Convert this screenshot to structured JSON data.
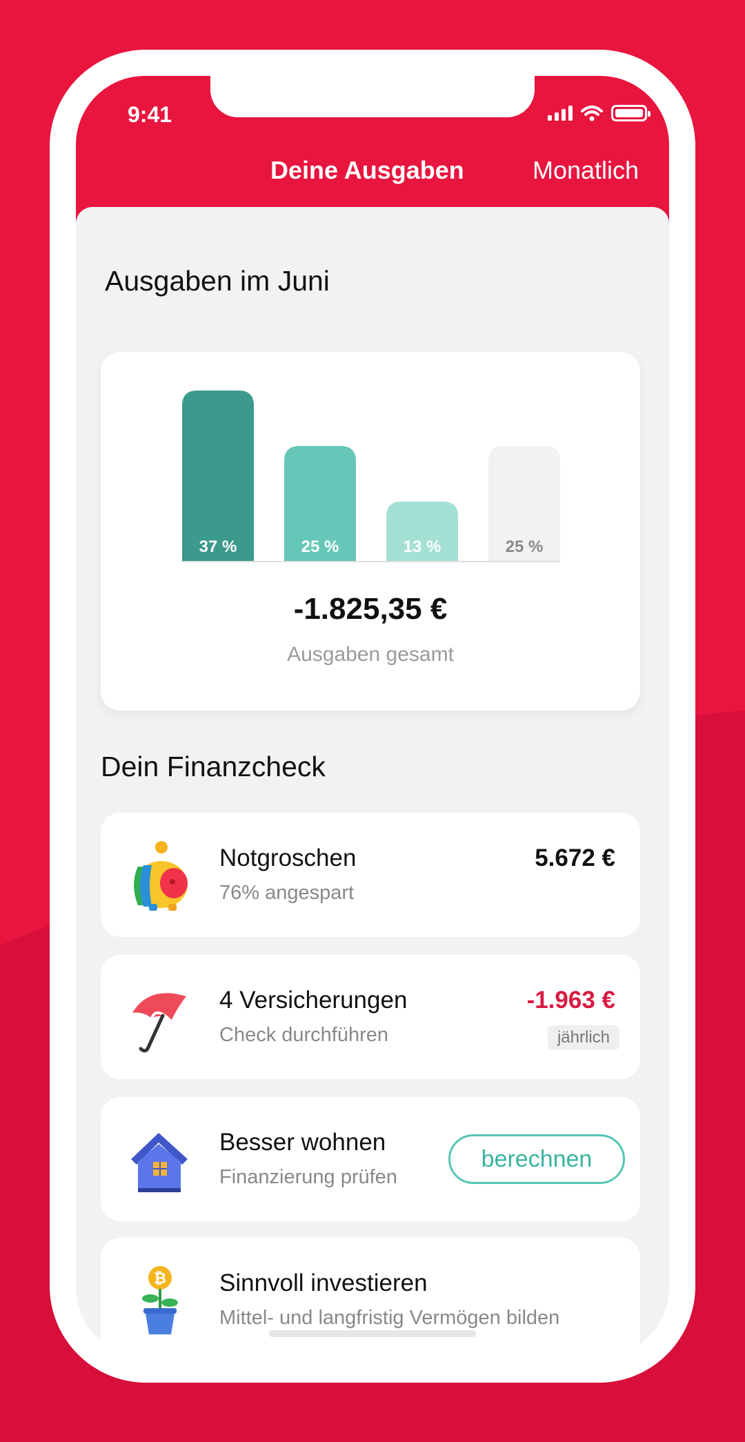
{
  "status_bar": {
    "time": "9:41"
  },
  "header": {
    "title": "Deine Ausgaben",
    "period": "Monatlich"
  },
  "spending": {
    "section_title": "Ausgaben im Juni",
    "total": "-1.825,35 €",
    "total_caption": "Ausgaben gesamt"
  },
  "chart_data": {
    "type": "bar",
    "categories": [
      "",
      "",
      "",
      ""
    ],
    "values": [
      37,
      25,
      13,
      25
    ],
    "labels": [
      "37 %",
      "25 %",
      "13 %",
      "25 %"
    ],
    "colors": [
      "#3c9a8c",
      "#66c7b8",
      "#a5e0d5",
      "#f2f2f2"
    ],
    "label_colors": [
      "#ffffff",
      "#ffffff",
      "#ffffff",
      "#8a8a8a"
    ],
    "title": "",
    "xlabel": "",
    "ylabel": "",
    "ylim": [
      0,
      37
    ]
  },
  "finance_check": {
    "section_title": "Dein Finanzcheck",
    "items": [
      {
        "icon": "piggy-bank-icon",
        "title": "Notgroschen",
        "subtitle": "76% angespart",
        "value": "5.672 €"
      },
      {
        "icon": "umbrella-icon",
        "title": "4 Versicherungen",
        "subtitle": "Check durchführen",
        "value": "-1.963 €",
        "tag": "jährlich"
      },
      {
        "icon": "house-icon",
        "title": "Besser wohnen",
        "subtitle": "Finanzierung prüfen",
        "button": "berechnen"
      },
      {
        "icon": "coin-plant-icon",
        "title": "Sinnvoll investieren",
        "subtitle": "Mittel- und langfristig Vermögen bilden"
      }
    ]
  },
  "colors": {
    "brand": "#e8153e",
    "accent_teal": "#3c9a8c",
    "negative": "#d81b43"
  }
}
